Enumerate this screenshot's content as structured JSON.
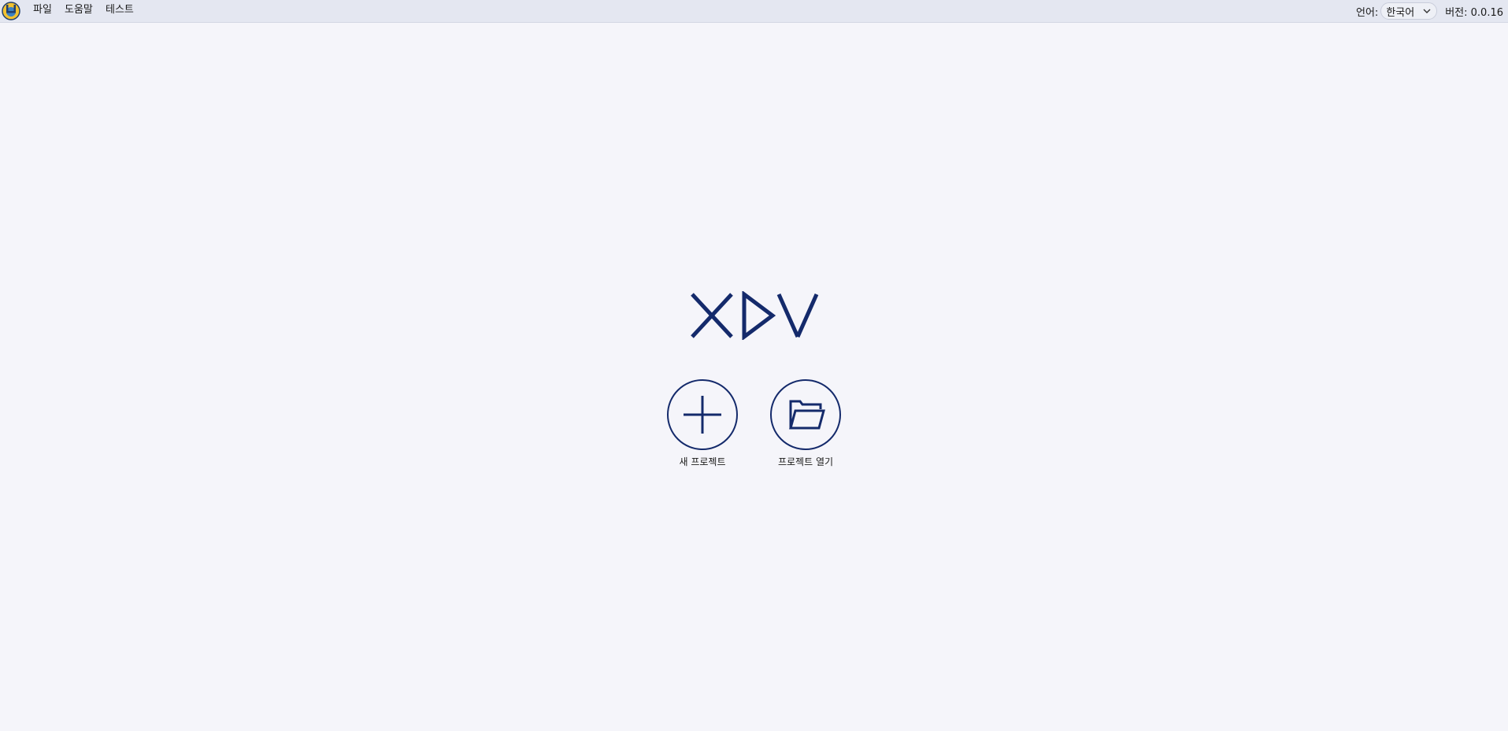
{
  "menubar": {
    "items": [
      {
        "label": "파일"
      },
      {
        "label": "도움말"
      },
      {
        "label": "테스트"
      }
    ],
    "language_label": "언어:",
    "language_value": "한국어",
    "version_text": "버전: 0.0.16"
  },
  "main": {
    "logo_text": "XDV",
    "actions": [
      {
        "label": "새 프로젝트",
        "icon": "plus-icon"
      },
      {
        "label": "프로젝트 열기",
        "icon": "folder-open-icon"
      }
    ]
  },
  "colors": {
    "accent": "#142a6b",
    "background": "#f5f5fa",
    "menubar": "#e4e7f1"
  }
}
